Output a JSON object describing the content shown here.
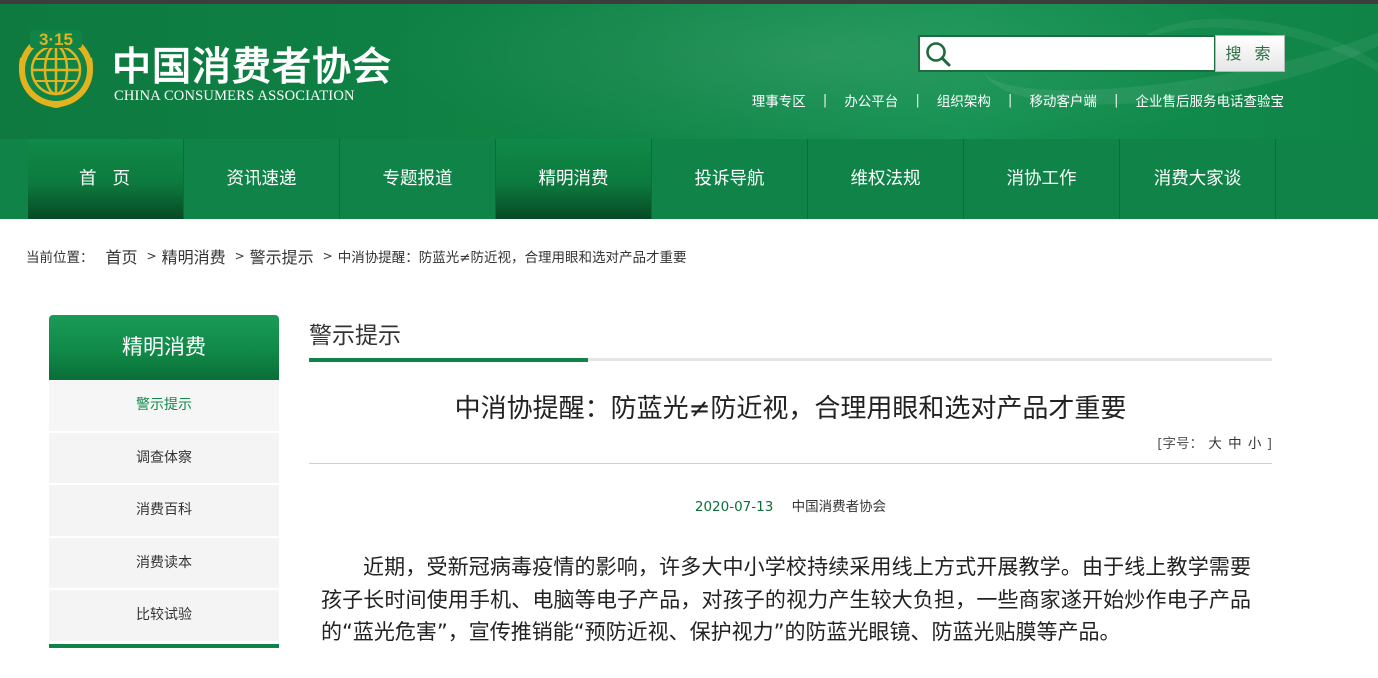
{
  "header": {
    "logo_cn": "中国消费者协会",
    "logo_en": "CHINA CONSUMERS ASSOCIATION",
    "emblem_text": "3·15",
    "search": {
      "placeholder": "",
      "button_label": "搜 索"
    },
    "top_links": [
      "理事专区",
      "办公平台",
      "组织架构",
      "移动客户端",
      "企业售后服务电话查验宝"
    ],
    "separator": "|"
  },
  "nav": {
    "items": [
      "首页",
      "资讯速递",
      "专题报道",
      "精明消费",
      "投诉导航",
      "维权法规",
      "消协工作",
      "消费大家谈"
    ],
    "active_index": 3
  },
  "breadcrumb": {
    "prefix": "当前位置：",
    "items": [
      "首页",
      "精明消费",
      "警示提示"
    ],
    "current": "中消协提醒：防蓝光≠防近视，合理用眼和选对产品才重要",
    "arrow": ">"
  },
  "sidebar": {
    "title": "精明消费",
    "items": [
      "警示提示",
      "调查体察",
      "消费百科",
      "消费读本",
      "比较试验"
    ],
    "active_index": 0
  },
  "main": {
    "section_title": "警示提示",
    "article_title": "中消协提醒：防蓝光≠防近视，合理用眼和选对产品才重要",
    "font_size": {
      "prefix": "[字号：",
      "large": "大",
      "medium": "中",
      "small": "小",
      "suffix": "]"
    },
    "date": "2020-07-13",
    "source": "中国消费者协会",
    "paragraph": "近期，受新冠病毒疫情的影响，许多大中小学校持续采用线上方式开展教学。由于线上教学需要孩子长时间使用手机、电脑等电子产品，对孩子的视力产生较大负担，一些商家遂开始炒作电子产品的“蓝光危害”，宣传推销能“预防近视、保护视力”的防蓝光眼镜、防蓝光贴膜等产品。"
  },
  "colors": {
    "brand_green": "#108448",
    "header_green": "#0f8446",
    "accent_text_green": "#0e8a47",
    "emblem_gold": "#e3b21f"
  }
}
